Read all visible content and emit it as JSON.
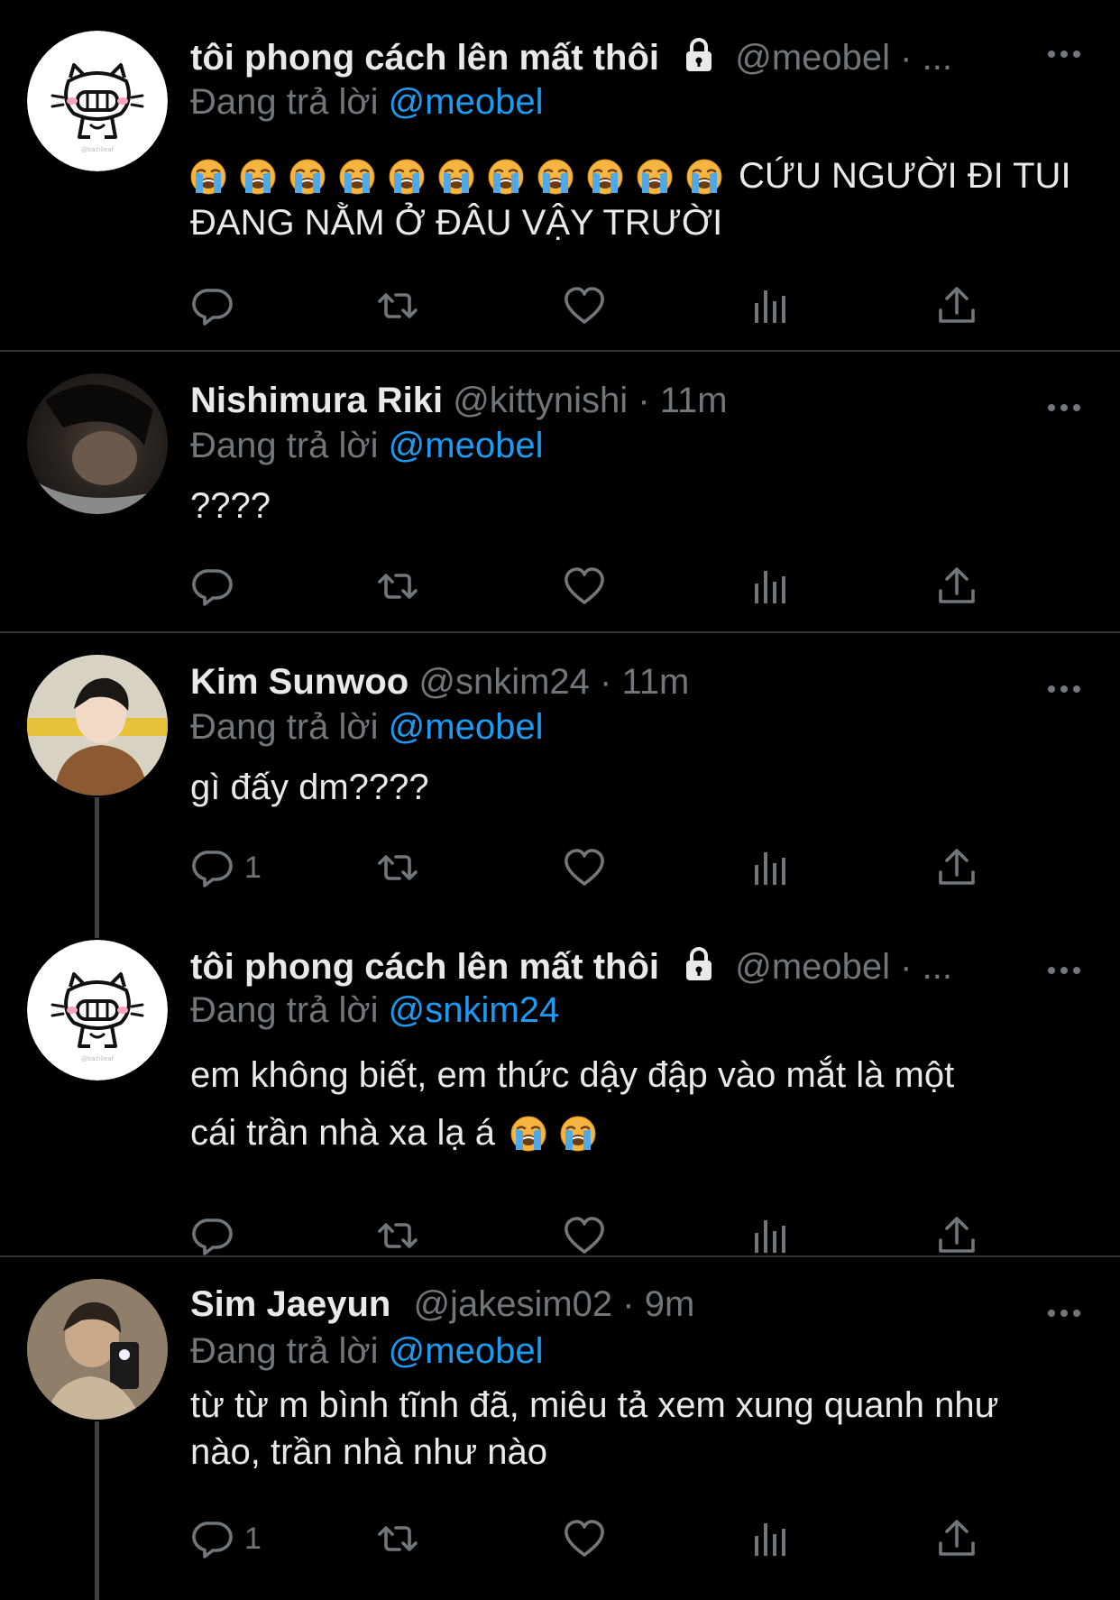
{
  "colors": {
    "background": "#000000",
    "text": "#e7e9ea",
    "muted": "#71767b",
    "mention": "#1d9bf0",
    "divider": "#2f3336"
  },
  "reply_prefix": "Đang trả lời",
  "tweets": [
    {
      "name": "tôi phong cách lên mất thôi",
      "protected": true,
      "handle": "@meobel",
      "meta": "· ...",
      "reply_to": "@meobel",
      "emoji": [
        "loudly-crying-face",
        "loudly-crying-face",
        "loudly-crying-face",
        "loudly-crying-face",
        "loudly-crying-face",
        "loudly-crying-face",
        "loudly-crying-face",
        "loudly-crying-face",
        "loudly-crying-face",
        "loudly-crying-face",
        "loudly-crying-face"
      ],
      "text_line1": "CỨU NGƯỜI ĐI TUI",
      "text_line2": "ĐANG NẰM Ở ĐÂU VẬY TRƯỜI",
      "reply_count": ""
    },
    {
      "name": "Nishimura Riki",
      "handle": "@kittynishi",
      "meta": "· 11m",
      "reply_to": "@meobel",
      "text": "????",
      "reply_count": ""
    },
    {
      "name": "Kim Sunwoo",
      "handle": "@snkim24",
      "meta": "· 11m",
      "reply_to": "@meobel",
      "text": "gì đấy dm????",
      "reply_count": "1"
    },
    {
      "name": "tôi phong cách lên mất thôi",
      "protected": true,
      "handle": "@meobel",
      "meta": "· ...",
      "reply_to": "@snkim24",
      "text_line1": "em không biết, em thức dậy đập vào mắt là một",
      "text_line2": "cái trần nhà xa lạ á",
      "emoji": [
        "loudly-crying-face",
        "loudly-crying-face"
      ],
      "reply_count": ""
    },
    {
      "name": "Sim Jaeyun",
      "handle": "@jakesim02",
      "meta": "· 9m",
      "reply_to": "@meobel",
      "text_line1": "từ từ m bình tĩnh đã, miêu tả xem xung quanh như",
      "text_line2": "nào, trần nhà như nào",
      "reply_count": "1"
    }
  ]
}
